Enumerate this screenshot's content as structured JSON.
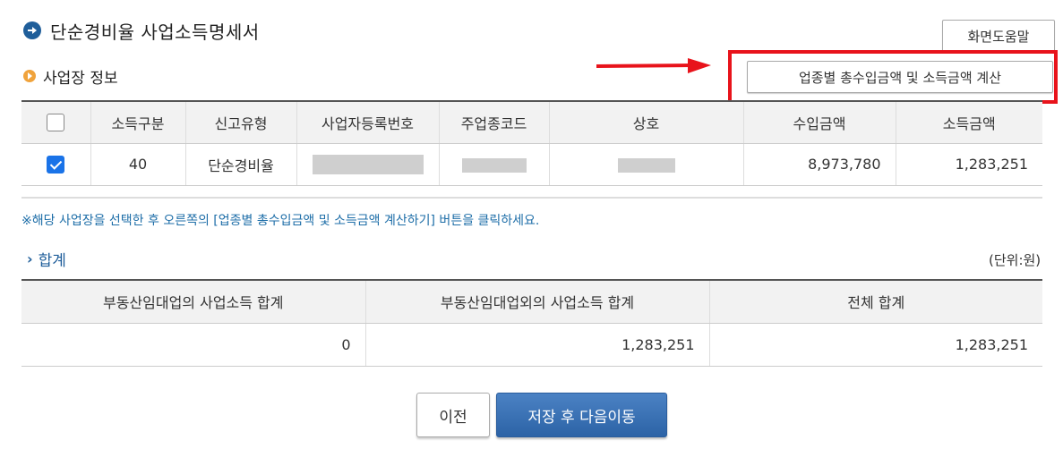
{
  "page": {
    "title": "단순경비율 사업소득명세서",
    "help_button": "화면도움말",
    "section_title": "사업장 정보",
    "calc_button": "업종별 총수입금액 및 소득금액 계산",
    "highlight_color": "#e8131b"
  },
  "business_table": {
    "headers": [
      "소득구분",
      "신고유형",
      "사업자등록번호",
      "주업종코드",
      "상호",
      "수입금액",
      "소득금액"
    ],
    "rows": [
      {
        "checked": true,
        "income_type": "40",
        "report_type": "단순경비율",
        "business_number": "",
        "industry_code": "",
        "company_name": "",
        "revenue": "8,973,780",
        "income": "1,283,251"
      }
    ]
  },
  "note": "※해당 사업장을 선택한 후 오른쪽의 [업종별 총수입금액 및 소득금액 계산하기] 버튼을 클릭하세요.",
  "summary": {
    "title": "합계",
    "unit": "(단위:원)",
    "headers": [
      "부동산임대업의 사업소득 합계",
      "부동산임대업외의 사업소득 합계",
      "전체 합계"
    ],
    "values": [
      "0",
      "1,283,251",
      "1,283,251"
    ]
  },
  "buttons": {
    "prev": "이전",
    "next": "저장 후 다음이동"
  }
}
